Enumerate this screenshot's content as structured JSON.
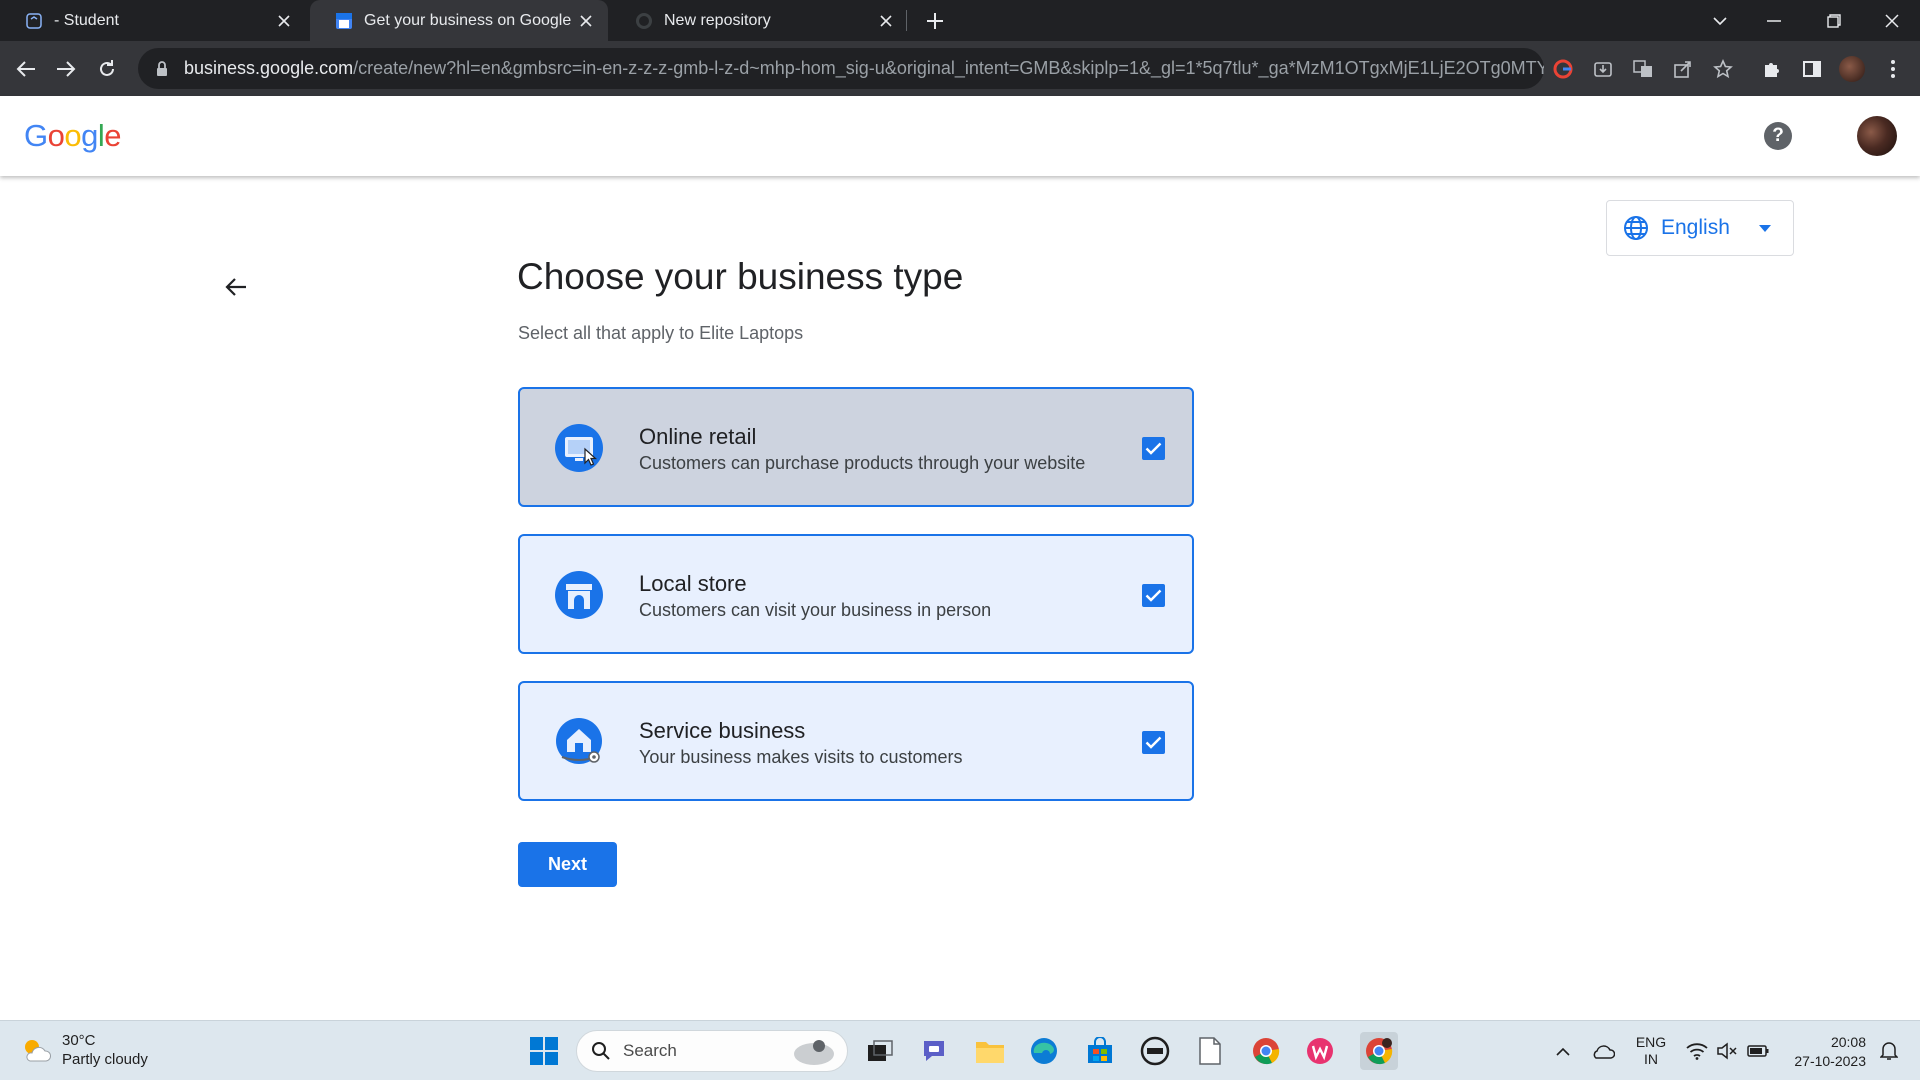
{
  "browser": {
    "tabs": [
      {
        "title": "- Student",
        "active": false
      },
      {
        "title": "Get your business on Google",
        "active": true
      },
      {
        "title": "New repository",
        "active": false
      }
    ],
    "url_host": "business.google.com",
    "url_rest": "/create/new?hl=en&gmbsrc=in-en-z-z-z-gmb-l-z-d~mhp-hom_sig-u&original_intent=GMB&skiplp=1&_gl=1*5q7tlu*_ga*MzM1OTgxMjE1LjE2OTg0MTY..."
  },
  "header": {
    "logo_letters": [
      "G",
      "o",
      "o",
      "g",
      "l",
      "e"
    ],
    "help_label": "?"
  },
  "language": {
    "label": "English"
  },
  "page": {
    "title": "Choose your business type",
    "subtitle": "Select all that apply to Elite Laptops"
  },
  "options": [
    {
      "title": "Online retail",
      "description": "Customers can purchase products through your website",
      "checked": true,
      "icon": "online-retail-icon"
    },
    {
      "title": "Local store",
      "description": "Customers can visit your business in person",
      "checked": true,
      "icon": "storefront-icon"
    },
    {
      "title": "Service business",
      "description": "Your business makes visits to customers",
      "checked": true,
      "icon": "house-location-icon"
    }
  ],
  "next_label": "Next",
  "taskbar": {
    "weather_temp": "30°C",
    "weather_desc": "Partly cloudy",
    "search_label": "Search",
    "lang_top": "ENG",
    "lang_bottom": "IN",
    "time": "20:08",
    "date": "27-10-2023"
  },
  "colors": {
    "accent": "#1a73e8",
    "card_bg": "#e8f0fe",
    "card_hover_bg": "#cdd3df",
    "chrome_dark": "#202124"
  }
}
